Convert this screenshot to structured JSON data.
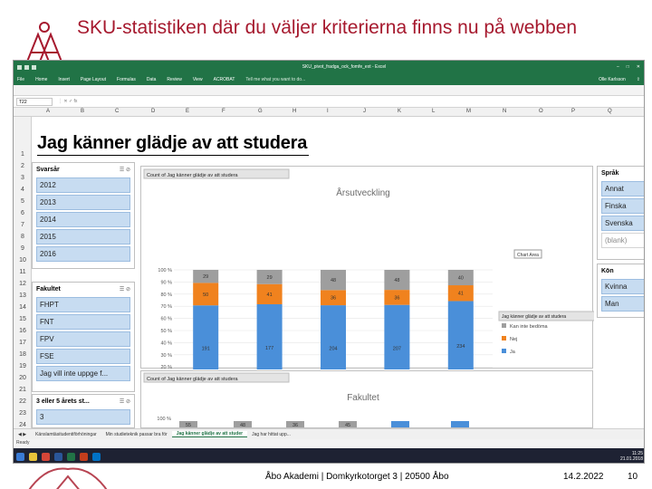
{
  "slide": {
    "title": "SKU-statistiken där du väljer kriterierna finns nu på webben",
    "footer_address": "Åbo Akademi | Domkyrkotorget 3 | 20500 Åbo",
    "footer_date": "14.2.2022",
    "page_number": "10"
  },
  "excel": {
    "window_title": "SKU_pivot_fradga_ock_fomfe_ext - Excel",
    "user": "Olle Karlsson",
    "tabs": [
      "File",
      "Home",
      "Insert",
      "Page Layout",
      "Formulas",
      "Data",
      "Review",
      "View",
      "ACROBAT"
    ],
    "tell_me": "Tell me what you want to do...",
    "name_box": "T22",
    "columns": [
      "A",
      "B",
      "C",
      "D",
      "E",
      "F",
      "G",
      "H",
      "I",
      "J",
      "K",
      "L",
      "M",
      "N",
      "O",
      "P",
      "Q"
    ],
    "rows": [
      "1",
      "2",
      "3",
      "4",
      "5",
      "6",
      "7",
      "8",
      "9",
      "10",
      "11",
      "12",
      "13",
      "14",
      "15",
      "16",
      "17",
      "18",
      "19",
      "20",
      "21",
      "22",
      "23",
      "24"
    ],
    "sheet_title": "Jag känner glädje av att studera",
    "sheet_tabs": [
      "Känslamtäsitudentiförhöningar",
      "Min studieteknik passar bra för",
      "Jag känner glädje av att studer",
      "Jag har hittat upp..."
    ],
    "active_sheet_index": 2,
    "status_left": "Ready",
    "clock_time": "11:25",
    "clock_date": "21.01.2018"
  },
  "slicers": {
    "year": {
      "title": "Svarsår",
      "items": [
        "2012",
        "2013",
        "2014",
        "2015",
        "2016"
      ]
    },
    "faculty": {
      "title": "Fakultet",
      "items": [
        "FHPT",
        "FNT",
        "FPV",
        "FSE",
        "Jag vill inte uppge f..."
      ]
    },
    "years_study": {
      "title": "3 eller 5 årets st...",
      "items": [
        "3"
      ]
    },
    "language": {
      "title": "Språk",
      "items": [
        "Annat",
        "Finska",
        "Svenska",
        "(blank)"
      ],
      "off_index": 3
    },
    "gender": {
      "title": "Kön",
      "items": [
        "Kvinna",
        "Man"
      ]
    }
  },
  "chart_data": [
    {
      "type": "bar",
      "stacked": true,
      "percent": true,
      "title": "Årsutveckling",
      "field_button": "Count of Jag känner glädje av att studera",
      "axis_button": "Svarsår",
      "legend_field": "Jag känner glädje av att studera",
      "chart_area_label": "Chart Area",
      "categories": [
        "2012",
        "2013",
        "2014",
        "2015",
        "2016"
      ],
      "yticks": [
        "0 %",
        "10 %",
        "20 %",
        "30 %",
        "40 %",
        "50 %",
        "60 %",
        "70 %",
        "80 %",
        "90 %",
        "100 %"
      ],
      "ylim": [
        0,
        100
      ],
      "legend_position": "right",
      "series": [
        {
          "name": "Ja",
          "color": "#4a8fd9",
          "values": [
            191,
            177,
            204,
            207,
            234
          ]
        },
        {
          "name": "Nej",
          "color": "#f0821e",
          "values": [
            50,
            41,
            36,
            36,
            41
          ]
        },
        {
          "name": "Kan inte bedöma",
          "color": "#9e9e9e",
          "values": [
            29,
            29,
            48,
            48,
            40
          ]
        }
      ]
    },
    {
      "type": "bar",
      "title": "Fakultet",
      "field_button": "Count of Jag känner glädje av att studera",
      "ytick_top": "100 %",
      "visible_labels": [
        "55",
        "48",
        "36",
        "45"
      ]
    }
  ]
}
